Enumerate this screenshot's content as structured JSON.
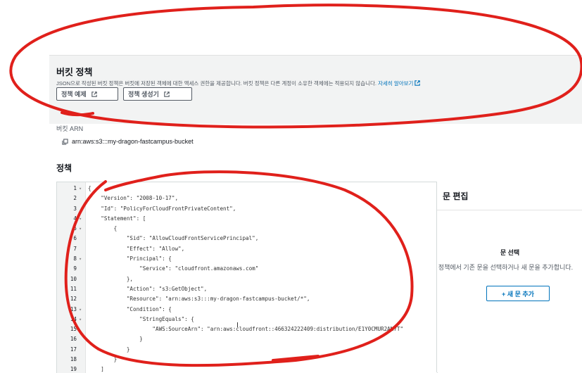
{
  "bucket_policy": {
    "title": "버킷 정책",
    "description": "JSON으로 작성된 버킷 정책은 버킷에 저장된 객체에 대한 액세스 권한을 제공합니다. 버킷 정책은 다른 계정이 소유한 객체에는 적용되지 않습니다.",
    "learn_more": "자세히 알아보기",
    "example_button": "정책 예제",
    "generator_button": "정책 생성기"
  },
  "arn": {
    "label": "버킷 ARN",
    "value": "arn:aws:s3:::my-dragon-fastcampus-bucket"
  },
  "policy": {
    "label": "정책",
    "lines": [
      {
        "n": "1",
        "fold": true,
        "text": "{"
      },
      {
        "n": "2",
        "fold": false,
        "text": "    \"Version\": \"2008-10-17\","
      },
      {
        "n": "3",
        "fold": false,
        "text": "    \"Id\": \"PolicyForCloudFrontPrivateContent\","
      },
      {
        "n": "4",
        "fold": true,
        "text": "    \"Statement\": ["
      },
      {
        "n": "5",
        "fold": true,
        "text": "        {"
      },
      {
        "n": "6",
        "fold": false,
        "text": "            \"Sid\": \"AllowCloudFrontServicePrincipal\","
      },
      {
        "n": "7",
        "fold": false,
        "text": "            \"Effect\": \"Allow\","
      },
      {
        "n": "8",
        "fold": true,
        "text": "            \"Principal\": {"
      },
      {
        "n": "9",
        "fold": false,
        "text": "                \"Service\": \"cloudfront.amazonaws.com\""
      },
      {
        "n": "10",
        "fold": false,
        "text": "            },"
      },
      {
        "n": "11",
        "fold": false,
        "text": "            \"Action\": \"s3:GetObject\","
      },
      {
        "n": "12",
        "fold": false,
        "text": "            \"Resource\": \"arn:aws:s3:::my-dragon-fastcampus-bucket/*\","
      },
      {
        "n": "13",
        "fold": true,
        "text": "            \"Condition\": {"
      },
      {
        "n": "14",
        "fold": true,
        "text": "                \"StringEquals\": {"
      },
      {
        "n": "15",
        "fold": false,
        "text": "                    \"AWS:SourceArn\": \"arn:aws:cloudfront::466324222409:distribution/E1Y0CMUR2AN7T\""
      },
      {
        "n": "16",
        "fold": false,
        "text": "                }"
      },
      {
        "n": "17",
        "fold": false,
        "text": "            }"
      },
      {
        "n": "18",
        "fold": false,
        "text": "        }"
      },
      {
        "n": "19",
        "fold": false,
        "text": "    ]"
      }
    ]
  },
  "statement_editor": {
    "title": "문 편집",
    "subtitle": "문 선택",
    "description": "정책에서 기존 문을 선택하거나 새 문을 추가합니다.",
    "add_button": "+ 새 문 추가"
  },
  "colors": {
    "annotation": "#e0201b",
    "link": "#0073bb"
  }
}
